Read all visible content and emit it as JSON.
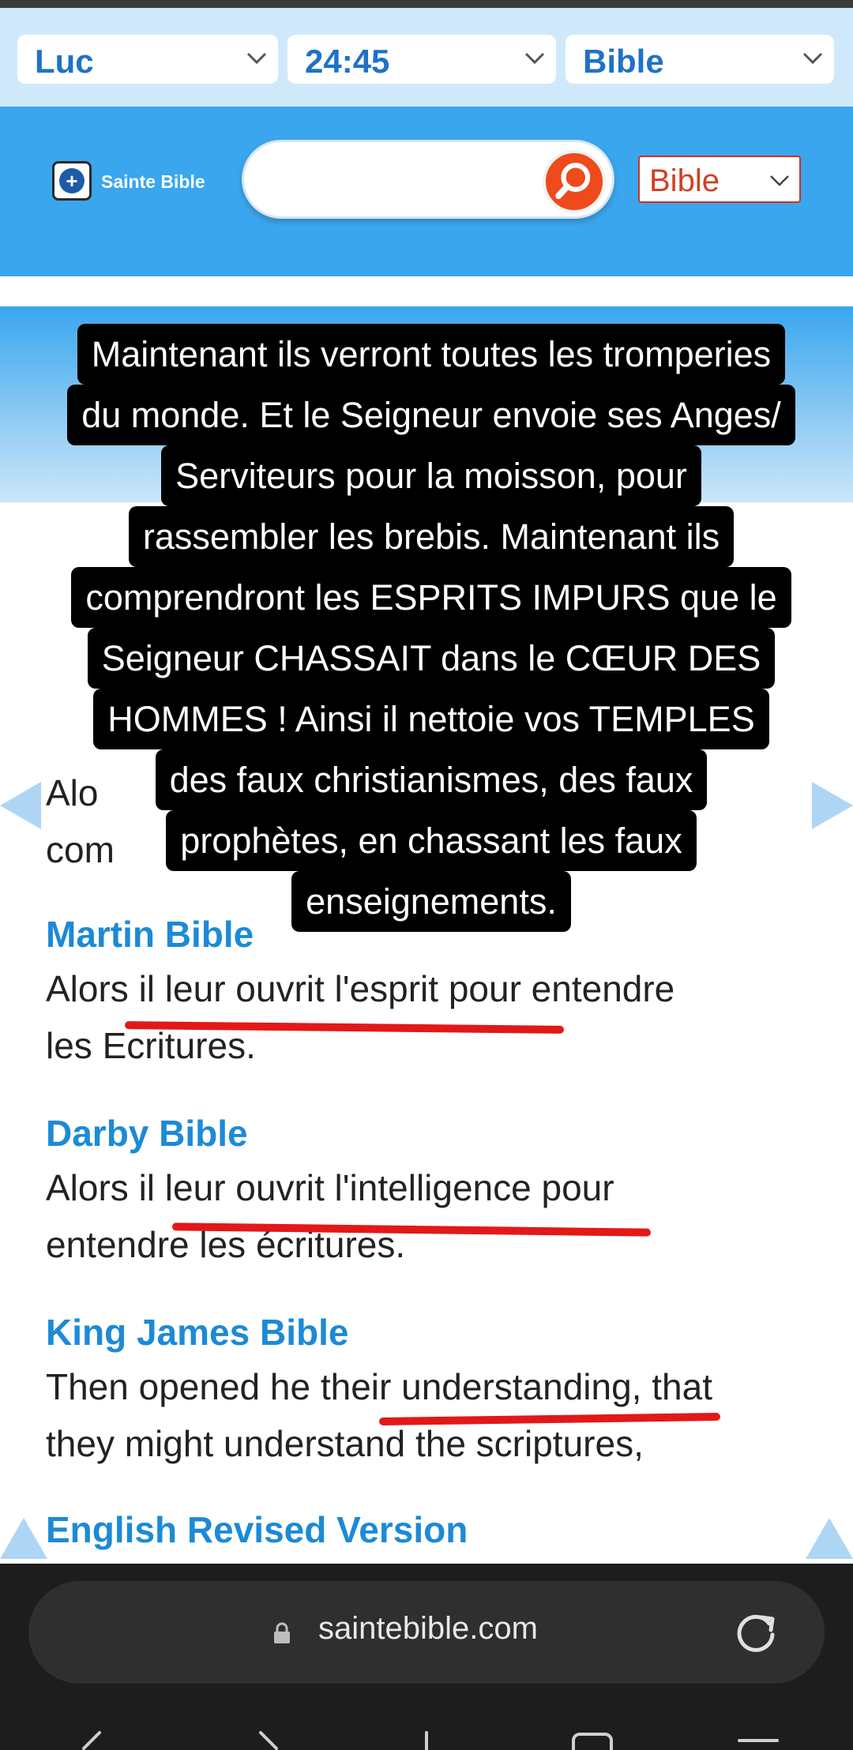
{
  "selectors": {
    "book": "Luc",
    "chapter_verse": "24:45",
    "source": "Bible"
  },
  "header": {
    "logo_text": "Sainte Bible",
    "search_placeholder": "",
    "version_select": "Bible"
  },
  "overlay_caption": [
    "Maintenant ils verront toutes les tromperies",
    "du monde. Et le Seigneur envoie ses Anges/",
    "Serviteurs  pour la moisson, pour",
    "rassembler les brebis. Maintenant ils",
    "comprendront les ESPRITS IMPURS que le",
    "Seigneur CHASSAIT dans le CŒUR DES",
    "HOMMES ! Ainsi il nettoie vos TEMPLES",
    "des faux christianismes, des faux",
    "prophètes, en chassant les faux",
    "enseignements."
  ],
  "verses": [
    {
      "heading": "",
      "lines": [
        "Alo",
        "com"
      ]
    },
    {
      "heading": "Martin Bible",
      "lines": [
        "Alors il leur ouvrit l'esprit pour entendre",
        "les Ecritures."
      ]
    },
    {
      "heading": "Darby Bible",
      "lines": [
        "Alors il leur ouvrit l'intelligence pour",
        "entendre les écritures."
      ]
    },
    {
      "heading": "King James Bible",
      "lines": [
        "Then opened he their understanding, that",
        "they might understand the scriptures,"
      ]
    },
    {
      "heading": "English Revised Version",
      "lines": []
    }
  ],
  "browser": {
    "url": "saintebible.com"
  },
  "colors": {
    "selector_bar": "#cfe9fb",
    "header_blue": "#3aa6ee",
    "heading_blue": "#1c8ad6",
    "underline_red": "#e31818",
    "search_orange": "#ee4a1c"
  },
  "icons": {
    "chevron": "chevron-down-icon",
    "search": "search-icon",
    "lock": "lock-icon",
    "reload": "reload-icon"
  }
}
